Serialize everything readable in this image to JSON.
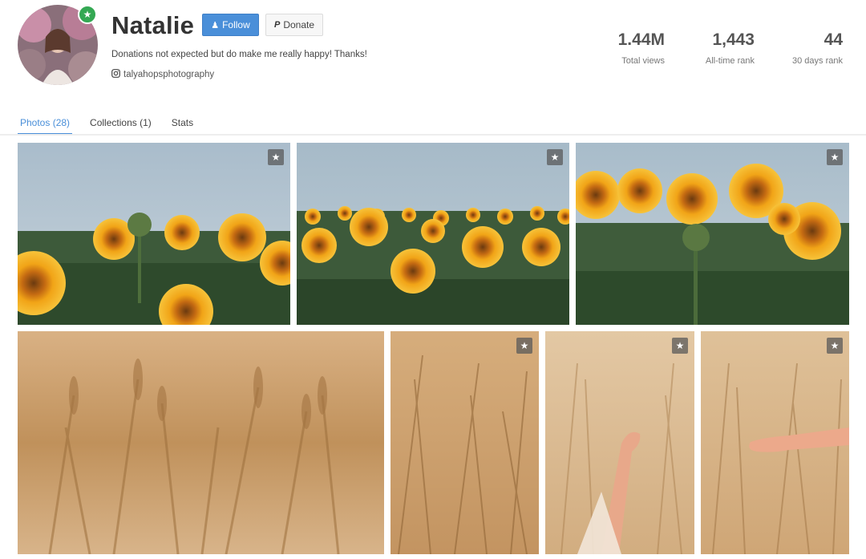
{
  "profile": {
    "name": "Natalie",
    "follow_label": "Follow",
    "donate_label": "Donate",
    "bio": "Donations not expected but do make me really happy! Thanks!",
    "instagram": "talyahopsphotography",
    "verified_icon": "star-icon"
  },
  "stats": [
    {
      "value": "1.44M",
      "label": "Total views"
    },
    {
      "value": "1,443",
      "label": "All-time rank"
    },
    {
      "value": "44",
      "label": "30 days rank"
    }
  ],
  "tabs": [
    {
      "label": "Photos (28)",
      "active": true
    },
    {
      "label": "Collections (1)",
      "active": false
    },
    {
      "label": "Stats",
      "active": false
    }
  ],
  "colors": {
    "accent": "#4a8fd9",
    "verified": "#34a853"
  },
  "photos": [
    {
      "subject": "sunflower field"
    },
    {
      "subject": "sunflower field"
    },
    {
      "subject": "sunflower field"
    },
    {
      "subject": "wheat field"
    },
    {
      "subject": "wheat field"
    },
    {
      "subject": "hand in wheat field"
    },
    {
      "subject": "hand in wheat field"
    }
  ]
}
